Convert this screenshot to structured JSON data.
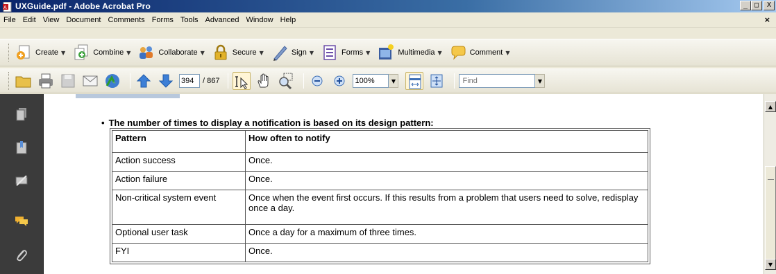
{
  "window": {
    "title": "UXGuide.pdf - Adobe Acrobat Pro",
    "controls": {
      "minimize": "_",
      "maximize": "□",
      "close": "X"
    }
  },
  "menu": {
    "items": [
      "File",
      "Edit",
      "View",
      "Document",
      "Comments",
      "Forms",
      "Tools",
      "Advanced",
      "Window",
      "Help"
    ],
    "close_label": "×"
  },
  "tasks": [
    {
      "label": "Create",
      "icon": "create-icon"
    },
    {
      "label": "Combine",
      "icon": "combine-icon"
    },
    {
      "label": "Collaborate",
      "icon": "collaborate-icon"
    },
    {
      "label": "Secure",
      "icon": "lock-icon"
    },
    {
      "label": "Sign",
      "icon": "pen-icon"
    },
    {
      "label": "Forms",
      "icon": "form-icon"
    },
    {
      "label": "Multimedia",
      "icon": "film-icon"
    },
    {
      "label": "Comment",
      "icon": "comment-icon"
    }
  ],
  "toolbar": {
    "current_page": "394",
    "total_pages": "/ 867",
    "zoom": "100%",
    "find_placeholder": "Find"
  },
  "document": {
    "bullet": "The number of times to display a notification is based on its design pattern:",
    "table": {
      "headers": [
        "Pattern",
        "How often to notify"
      ],
      "rows": [
        [
          "Action success",
          "Once."
        ],
        [
          "Action failure",
          "Once."
        ],
        [
          "Non-critical system event",
          "Once when the event first occurs. If this results from a problem that users need to solve, redisplay once a day."
        ],
        [
          "Optional user task",
          "Once a day for a maximum of three times."
        ],
        [
          "FYI",
          "Once."
        ]
      ]
    }
  },
  "colors": {
    "titlebar_start": "#0a246a",
    "titlebar_end": "#a6caf0",
    "nav_panel": "#3b3b3b"
  }
}
